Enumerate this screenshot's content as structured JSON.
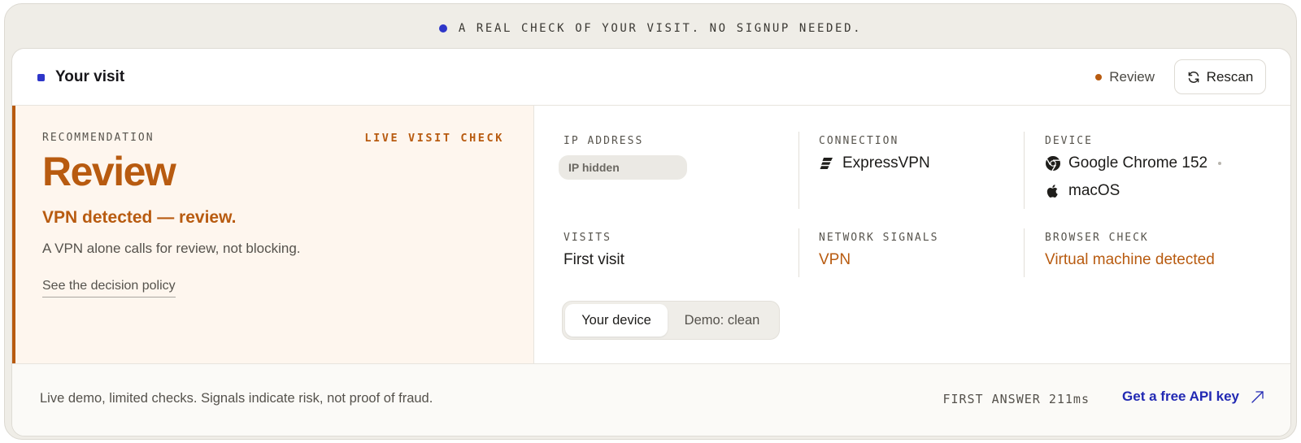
{
  "banner": {
    "text": "A REAL CHECK OF YOUR VISIT. NO SIGNUP NEEDED."
  },
  "header": {
    "title": "Your visit",
    "status": "Review",
    "rescan_label": "Rescan"
  },
  "recommendation": {
    "eyebrow": "RECOMMENDATION",
    "tag": "LIVE VISIT CHECK",
    "verdict": "Review",
    "headline": "VPN detected — review.",
    "description": "A VPN alone calls for review, not blocking.",
    "policy_link": "See the decision policy"
  },
  "signals": {
    "ip": {
      "label": "IP ADDRESS",
      "value": "IP hidden"
    },
    "connection": {
      "label": "CONNECTION",
      "value": "ExpressVPN",
      "icon": "expressvpn-icon"
    },
    "device": {
      "label": "DEVICE",
      "browser": "Google Chrome 152",
      "browser_icon": "chrome-icon",
      "os": "macOS",
      "os_icon": "apple-icon"
    },
    "visits": {
      "label": "VISITS",
      "value": "First visit"
    },
    "network": {
      "label": "NETWORK SIGNALS",
      "value": "VPN"
    },
    "browser_check": {
      "label": "BROWSER CHECK",
      "value": "Virtual machine detected"
    }
  },
  "toggle": {
    "options": [
      "Your device",
      "Demo: clean"
    ],
    "selected": "Your device"
  },
  "footer": {
    "note": "Live demo, limited checks. Signals indicate risk, not proof of fraud.",
    "first_answer": "FIRST ANSWER 211ms",
    "cta": "Get a free API key"
  },
  "colors": {
    "accent": "#b85b10",
    "brand": "#2e36c9",
    "link": "#2229b3"
  }
}
